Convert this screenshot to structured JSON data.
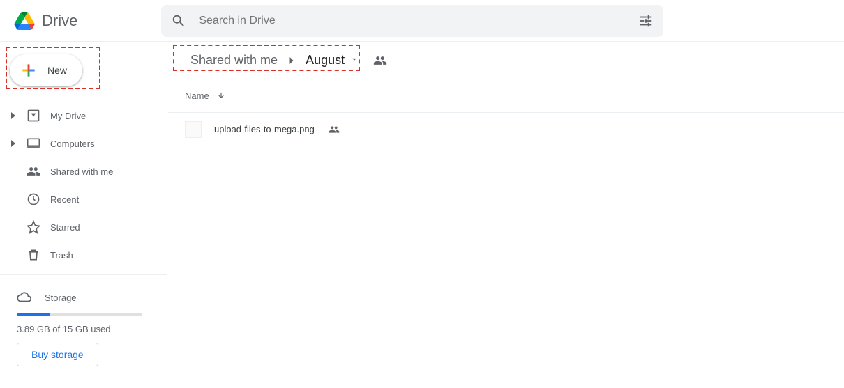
{
  "app": {
    "title": "Drive"
  },
  "search": {
    "placeholder": "Search in Drive"
  },
  "sidebar": {
    "new_label": "New",
    "items": [
      {
        "label": "My Drive",
        "expandable": true
      },
      {
        "label": "Computers",
        "expandable": true
      },
      {
        "label": "Shared with me",
        "expandable": false
      },
      {
        "label": "Recent",
        "expandable": false
      },
      {
        "label": "Starred",
        "expandable": false
      },
      {
        "label": "Trash",
        "expandable": false
      }
    ],
    "storage_label": "Storage",
    "storage_used_text": "3.89 GB of 15 GB used",
    "storage_percent": 26,
    "buy_storage_label": "Buy storage"
  },
  "breadcrumb": {
    "parent": "Shared with me",
    "current": "August"
  },
  "columns": {
    "name": "Name"
  },
  "files": [
    {
      "name": "upload-files-to-mega.png",
      "shared": true
    }
  ],
  "highlights": {
    "new_button": true,
    "breadcrumb": true
  }
}
